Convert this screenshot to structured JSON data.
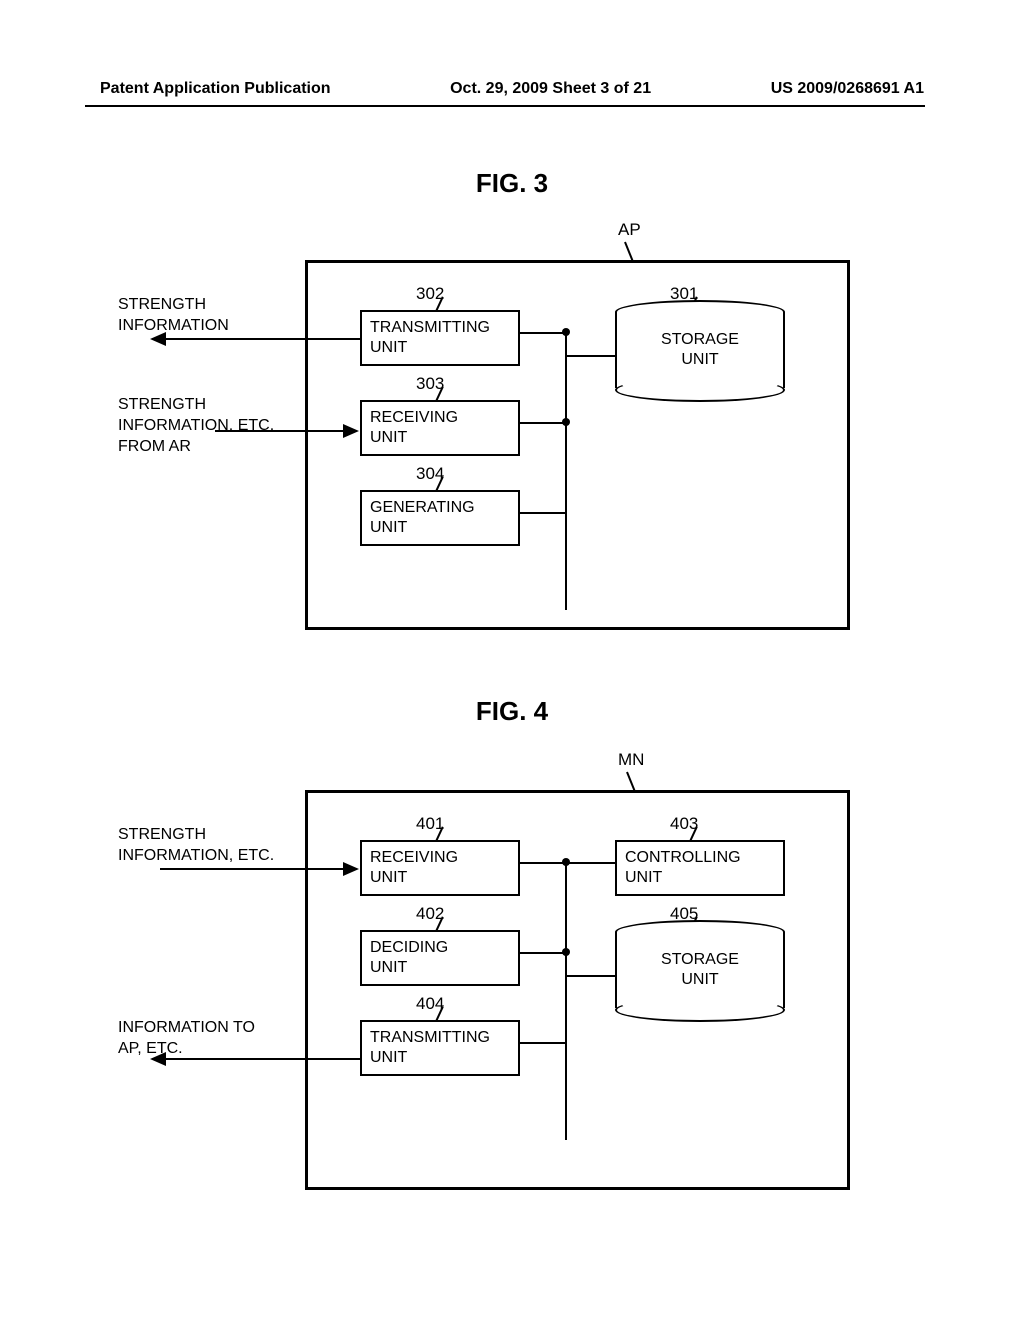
{
  "header": {
    "left": "Patent Application Publication",
    "center": "Oct. 29, 2009  Sheet 3 of 21",
    "right": "US 2009/0268691 A1"
  },
  "fig3": {
    "title": "FIG. 3",
    "ap_label": "AP",
    "ref_301": "301",
    "ref_302": "302",
    "ref_303": "303",
    "ref_304": "304",
    "block_302": "TRANSMITTING\nUNIT",
    "block_303": "RECEIVING\nUNIT",
    "block_304": "GENERATING\nUNIT",
    "block_301": "STORAGE\nUNIT",
    "ext_out": "STRENGTH\nINFORMATION",
    "ext_in": "STRENGTH\nINFORMATION, ETC.\nFROM AR"
  },
  "fig4": {
    "title": "FIG. 4",
    "mn_label": "MN",
    "ref_401": "401",
    "ref_402": "402",
    "ref_403": "403",
    "ref_404": "404",
    "ref_405": "405",
    "block_401": "RECEIVING\nUNIT",
    "block_402": "DECIDING\nUNIT",
    "block_403": "CONTROLLING\nUNIT",
    "block_404": "TRANSMITTING\nUNIT",
    "block_405": "STORAGE\nUNIT",
    "ext_in": "STRENGTH\nINFORMATION, ETC.",
    "ext_out": "INFORMATION TO\nAP, ETC."
  }
}
